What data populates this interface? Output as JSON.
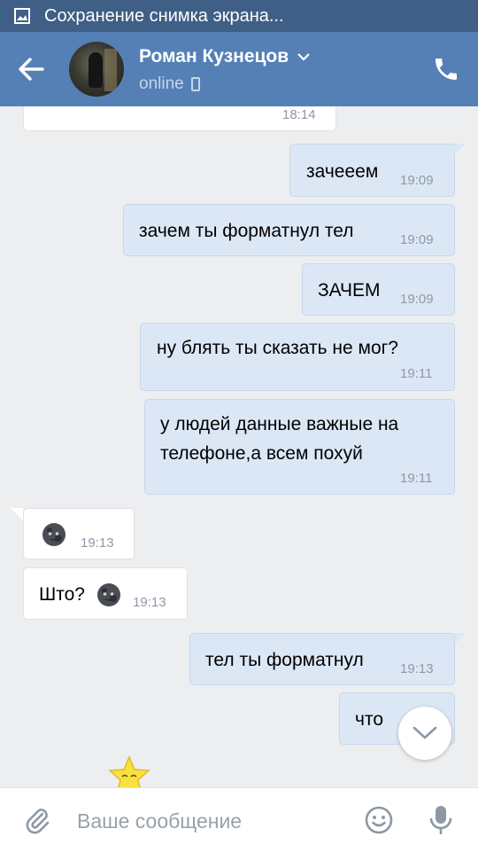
{
  "status_bar": {
    "notification": "Сохранение снимка экрана..."
  },
  "header": {
    "name": "Роман Кузнецов",
    "status": "online"
  },
  "messages": [
    {
      "dir": "in",
      "text": "",
      "time": "18:14"
    },
    {
      "dir": "out",
      "text": "зачееем",
      "time": "19:09"
    },
    {
      "dir": "out",
      "text": "зачем ты форматнул тел",
      "time": "19:09"
    },
    {
      "dir": "out",
      "text": "ЗАЧЕМ",
      "time": "19:09"
    },
    {
      "dir": "out",
      "text": "ну блять ты сказать не мог?",
      "time": "19:11"
    },
    {
      "dir": "out",
      "text_line1": "у людей данные важные на",
      "text_line2": "телефоне,а всем похуй",
      "time": "19:11"
    },
    {
      "dir": "in",
      "text": "",
      "emoji": "new-moon-face",
      "time": "19:13"
    },
    {
      "dir": "in",
      "text": "Што?",
      "emoji": "new-moon-face",
      "time": "19:13"
    },
    {
      "dir": "out",
      "text": "тел ты форматнул",
      "time": "19:13"
    },
    {
      "dir": "out",
      "text": "что",
      "time": ""
    }
  ],
  "composer": {
    "placeholder": "Ваше сообщение"
  },
  "colors": {
    "header": "#5480b6",
    "status_bar": "#3f5f86",
    "outgoing": "#dce7f6",
    "incoming": "#ffffff",
    "background": "#edeef0"
  }
}
